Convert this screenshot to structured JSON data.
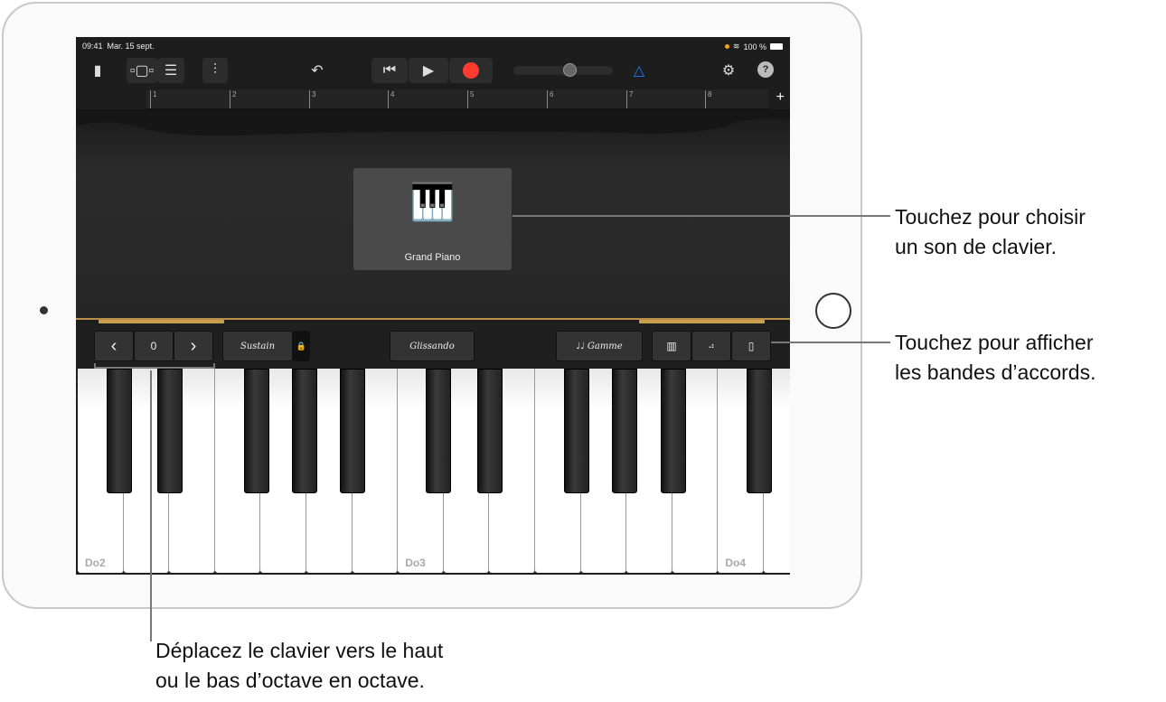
{
  "status": {
    "time": "09:41",
    "date": "Mar. 15 sept.",
    "battery": "100 %"
  },
  "toolbar": {
    "icons": [
      "document-icon",
      "tracks-view-icon",
      "browser-view-icon",
      "mixer-icon",
      "undo-icon",
      "rewind-icon",
      "play-icon",
      "record-icon",
      "volume-slider",
      "metronome-icon",
      "settings-icon",
      "help-icon"
    ],
    "help": "?",
    "record_color": "#ff3b30",
    "metronome_color": "#1e7cf2"
  },
  "ruler": {
    "bars": [
      "1",
      "2",
      "3",
      "4",
      "5",
      "6",
      "7",
      "8"
    ],
    "add": "+"
  },
  "instrument": {
    "name": "Grand Piano"
  },
  "controls": {
    "octave_down": "‹",
    "octave_value": "0",
    "octave_up": "›",
    "sustain": "Sustain",
    "glissando": "Glissando",
    "scale": "♩♩ Gamme"
  },
  "keyboard": {
    "labels": [
      "Do2",
      "Do3",
      "Do4"
    ]
  },
  "callouts": [
    {
      "line1": "Touchez pour choisir",
      "line2": "un son de clavier."
    },
    {
      "line1": "Touchez pour afficher",
      "line2": "les bandes d’accords."
    },
    {
      "line1": "Déplacez le clavier vers le haut",
      "line2": "ou le bas d’octave en octave."
    }
  ]
}
